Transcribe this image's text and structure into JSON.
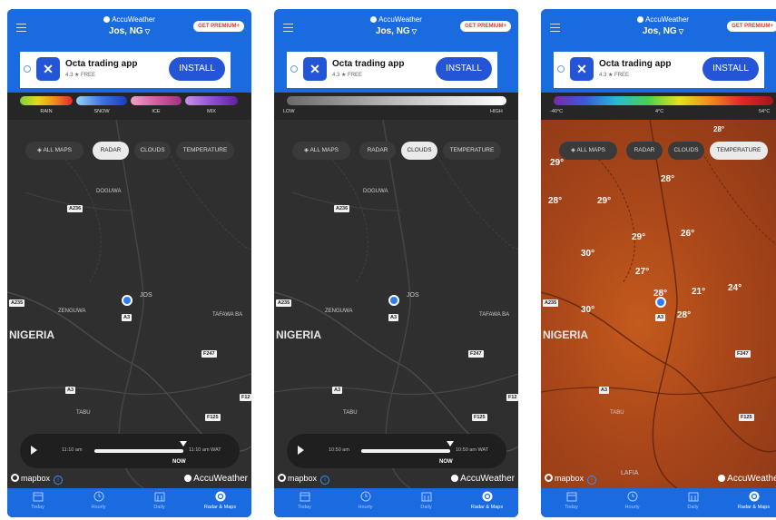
{
  "header": {
    "brand": "AccuWeather",
    "location": "Jos, NG",
    "premium_label": "GET PREMIUM+"
  },
  "ad": {
    "app_name": "Octa trading app",
    "rating": "4.3 ★  FREE",
    "install_label": "INSTALL"
  },
  "legend_radar": {
    "rain": "RAIN",
    "snow": "SNOW",
    "ice": "ICE",
    "mix": "MIX"
  },
  "legend_clouds": {
    "low": "LOW",
    "high": "HIGH"
  },
  "legend_temp": {
    "min": "-40°C",
    "mid": "4°C",
    "max": "54°C"
  },
  "chips": {
    "all_maps": "ALL MAPS",
    "radar": "RADAR",
    "clouds": "CLOUDS",
    "temperature": "TEMPERATURE"
  },
  "map": {
    "country": "NIGERIA",
    "places": {
      "doguwa": "DOGUWA",
      "jos": "JOS",
      "zenguwa": "ZENGUWA",
      "tafawa": "TAFAWA BA",
      "tabu": "TABU",
      "lafia": "LAFIA"
    },
    "roads": {
      "a236": "A236",
      "a235": "A235",
      "a3": "A3",
      "f247": "F247",
      "f125": "F125",
      "f12": "F12"
    },
    "temps": [
      "28°",
      "29°",
      "28°",
      "28°",
      "29°",
      "26°",
      "30°",
      "27°",
      "28°",
      "21°",
      "24°",
      "30°",
      "28°",
      "26°"
    ]
  },
  "timeline": {
    "radar_start": "11:10 am",
    "radar_end": "11:10 am WAT",
    "clouds_start": "10:50 am",
    "clouds_end": "10:50 am WAT",
    "now": "NOW"
  },
  "footer": {
    "mapbox": "mapbox",
    "info": "i",
    "accuweather": "AccuWeather"
  },
  "nav": {
    "today": "Today",
    "hourly": "Hourly",
    "daily": "Daily",
    "radar_maps": "Radar & Maps"
  },
  "colors": {
    "brand_blue": "#1a6be0",
    "ad_blue": "#2455d6",
    "premium_red": "#e2352b"
  }
}
